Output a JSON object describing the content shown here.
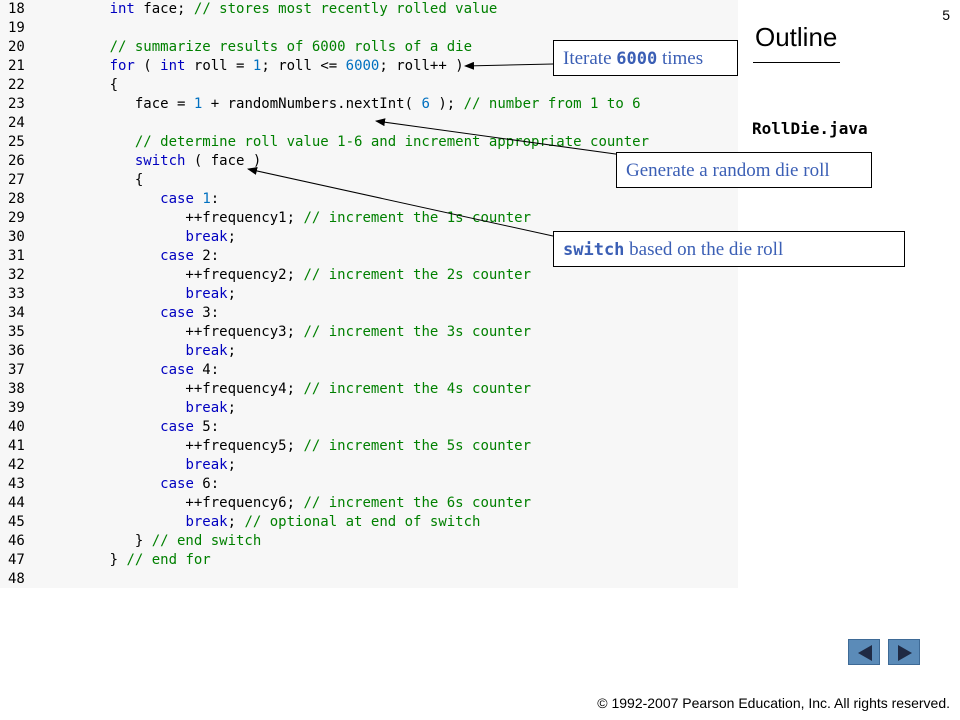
{
  "slide": {
    "page_number": "5",
    "outline_title": "Outline",
    "file_name": "RollDie.java",
    "copyright": "© 1992-2007 Pearson Education, Inc.  All rights reserved."
  },
  "code_lines": [
    {
      "n": "18",
      "segs": [
        {
          "t": "      "
        },
        {
          "t": "int",
          "c": "kw"
        },
        {
          "t": " face; "
        },
        {
          "t": "// stores most recently rolled value",
          "c": "cm"
        }
      ]
    },
    {
      "n": "19",
      "segs": []
    },
    {
      "n": "20",
      "segs": [
        {
          "t": "      "
        },
        {
          "t": "// summarize results of 6000 rolls of a die",
          "c": "cm"
        }
      ]
    },
    {
      "n": "21",
      "segs": [
        {
          "t": "      "
        },
        {
          "t": "for",
          "c": "kw"
        },
        {
          "t": " ( "
        },
        {
          "t": "int",
          "c": "kw"
        },
        {
          "t": " roll = "
        },
        {
          "t": "1",
          "c": "num"
        },
        {
          "t": "; roll <= "
        },
        {
          "t": "6000",
          "c": "num"
        },
        {
          "t": "; roll++ )"
        }
      ]
    },
    {
      "n": "22",
      "segs": [
        {
          "t": "      {"
        }
      ]
    },
    {
      "n": "23",
      "segs": [
        {
          "t": "         face = "
        },
        {
          "t": "1",
          "c": "num"
        },
        {
          "t": " + randomNumbers.nextInt( "
        },
        {
          "t": "6",
          "c": "num"
        },
        {
          "t": " ); "
        },
        {
          "t": "// number from 1 to 6",
          "c": "cm"
        }
      ]
    },
    {
      "n": "24",
      "segs": []
    },
    {
      "n": "25",
      "segs": [
        {
          "t": "         "
        },
        {
          "t": "// determine roll value 1-6 and increment appropriate counter",
          "c": "cm"
        }
      ]
    },
    {
      "n": "26",
      "segs": [
        {
          "t": "         "
        },
        {
          "t": "switch",
          "c": "kw"
        },
        {
          "t": " ( face )"
        }
      ]
    },
    {
      "n": "27",
      "segs": [
        {
          "t": "         {"
        }
      ]
    },
    {
      "n": "28",
      "segs": [
        {
          "t": "            "
        },
        {
          "t": "case",
          "c": "kw"
        },
        {
          "t": " "
        },
        {
          "t": "1",
          "c": "num"
        },
        {
          "t": ":"
        }
      ]
    },
    {
      "n": "29",
      "segs": [
        {
          "t": "               ++frequency1; "
        },
        {
          "t": "// increment the 1s counter",
          "c": "cm"
        }
      ]
    },
    {
      "n": "30",
      "segs": [
        {
          "t": "               "
        },
        {
          "t": "break",
          "c": "kw"
        },
        {
          "t": ";"
        }
      ]
    },
    {
      "n": "31",
      "segs": [
        {
          "t": "            "
        },
        {
          "t": "case",
          "c": "kw"
        },
        {
          "t": " 2:"
        }
      ]
    },
    {
      "n": "32",
      "segs": [
        {
          "t": "               ++frequency2; "
        },
        {
          "t": "// increment the 2s counter",
          "c": "cm"
        }
      ]
    },
    {
      "n": "33",
      "segs": [
        {
          "t": "               "
        },
        {
          "t": "break",
          "c": "kw"
        },
        {
          "t": ";"
        }
      ]
    },
    {
      "n": "34",
      "segs": [
        {
          "t": "            "
        },
        {
          "t": "case",
          "c": "kw"
        },
        {
          "t": " 3:"
        }
      ]
    },
    {
      "n": "35",
      "segs": [
        {
          "t": "               ++frequency3; "
        },
        {
          "t": "// increment the 3s counter",
          "c": "cm"
        }
      ]
    },
    {
      "n": "36",
      "segs": [
        {
          "t": "               "
        },
        {
          "t": "break",
          "c": "kw"
        },
        {
          "t": ";"
        }
      ]
    },
    {
      "n": "37",
      "segs": [
        {
          "t": "            "
        },
        {
          "t": "case",
          "c": "kw"
        },
        {
          "t": " 4:"
        }
      ]
    },
    {
      "n": "38",
      "segs": [
        {
          "t": "               ++frequency4; "
        },
        {
          "t": "// increment the 4s counter",
          "c": "cm"
        }
      ]
    },
    {
      "n": "39",
      "segs": [
        {
          "t": "               "
        },
        {
          "t": "break",
          "c": "kw"
        },
        {
          "t": ";"
        }
      ]
    },
    {
      "n": "40",
      "segs": [
        {
          "t": "            "
        },
        {
          "t": "case",
          "c": "kw"
        },
        {
          "t": " 5:"
        }
      ]
    },
    {
      "n": "41",
      "segs": [
        {
          "t": "               ++frequency5; "
        },
        {
          "t": "// increment the 5s counter",
          "c": "cm"
        }
      ]
    },
    {
      "n": "42",
      "segs": [
        {
          "t": "               "
        },
        {
          "t": "break",
          "c": "kw"
        },
        {
          "t": ";"
        }
      ]
    },
    {
      "n": "43",
      "segs": [
        {
          "t": "            "
        },
        {
          "t": "case",
          "c": "kw"
        },
        {
          "t": " 6:"
        }
      ]
    },
    {
      "n": "44",
      "segs": [
        {
          "t": "               ++frequency6; "
        },
        {
          "t": "// increment the 6s counter",
          "c": "cm"
        }
      ]
    },
    {
      "n": "45",
      "segs": [
        {
          "t": "               "
        },
        {
          "t": "break",
          "c": "kw"
        },
        {
          "t": "; "
        },
        {
          "t": "// optional at end of switch",
          "c": "cm"
        }
      ]
    },
    {
      "n": "46",
      "segs": [
        {
          "t": "         } "
        },
        {
          "t": "// end switch",
          "c": "cm"
        }
      ]
    },
    {
      "n": "47",
      "segs": [
        {
          "t": "      } "
        },
        {
          "t": "// end for",
          "c": "cm"
        }
      ]
    },
    {
      "n": "48",
      "segs": []
    }
  ],
  "callouts": {
    "iterate": {
      "pre": "Iterate ",
      "mono": "6000",
      "post": " times"
    },
    "random": {
      "text": "Generate a random die roll"
    },
    "switch": {
      "mono": "switch",
      "post": " based on the die roll"
    }
  },
  "colors": {
    "keyword": "#0000c0",
    "number": "#0070c0",
    "comment": "#008000",
    "callout_text": "#3b5fb5",
    "nav_button": "#5b8bb8"
  },
  "nav": {
    "prev_icon": "triangle-left-icon",
    "next_icon": "triangle-right-icon"
  }
}
